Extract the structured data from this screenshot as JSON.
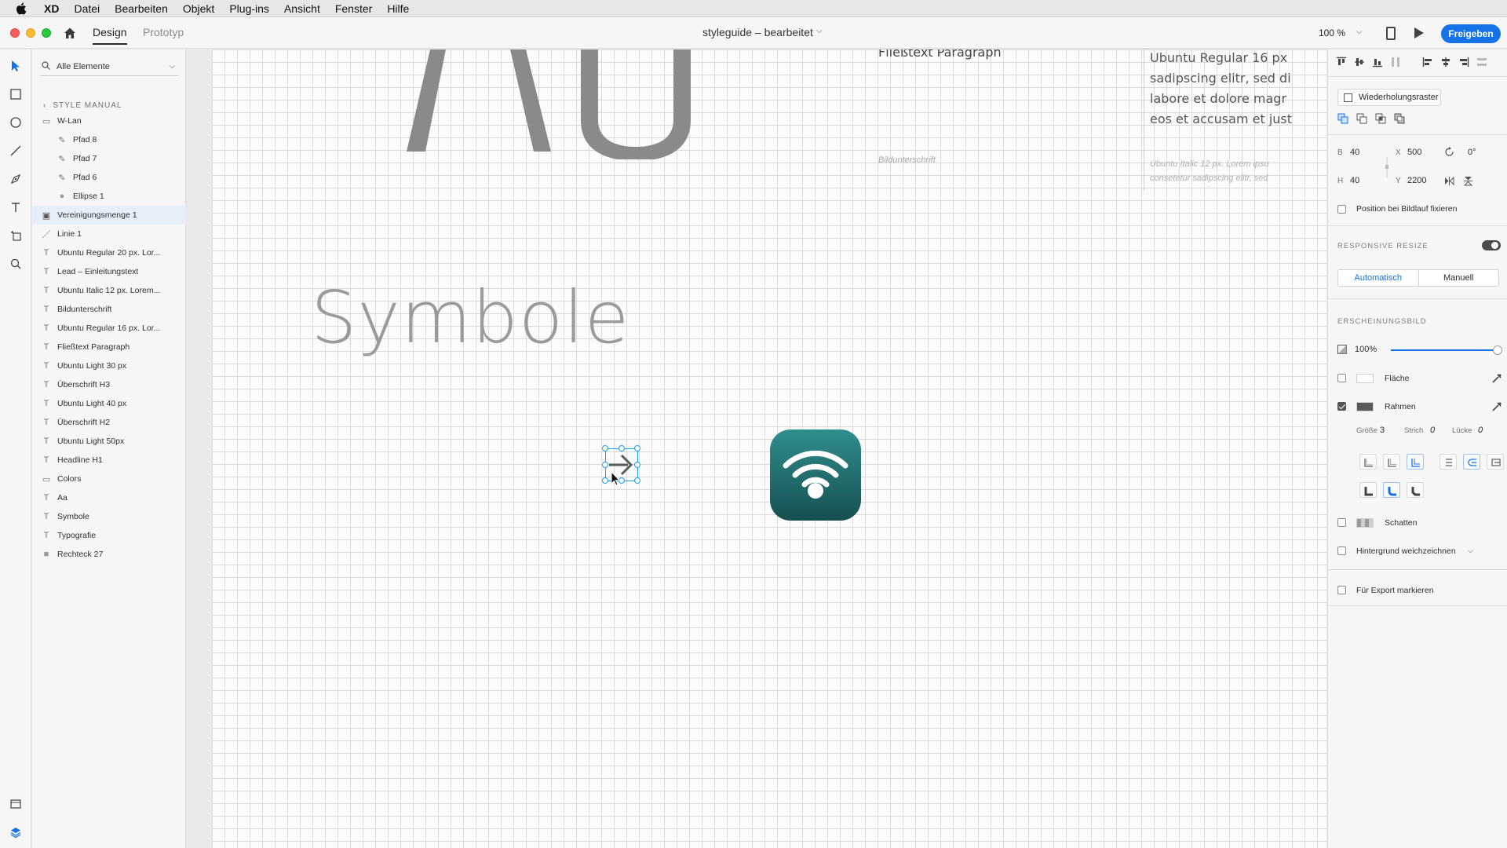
{
  "menubar": {
    "items": [
      "XD",
      "Datei",
      "Bearbeiten",
      "Objekt",
      "Plug-ins",
      "Ansicht",
      "Fenster",
      "Hilfe"
    ]
  },
  "appbar": {
    "tabs": [
      "Design",
      "Prototyp"
    ],
    "active_tab": "Design",
    "document_title": "styleguide – bearbeitet",
    "zoom": "100 %",
    "share_label": "Freigeben"
  },
  "layers": {
    "search_placeholder": "Alle Elemente",
    "breadcrumb": "STYLE MANUAL",
    "items": [
      {
        "name": "W-Lan",
        "type": "folder",
        "indent": 0
      },
      {
        "name": "Pfad 8",
        "type": "path",
        "indent": 1
      },
      {
        "name": "Pfad 7",
        "type": "path",
        "indent": 1
      },
      {
        "name": "Pfad 6",
        "type": "path",
        "indent": 1
      },
      {
        "name": "Ellipse 1",
        "type": "ellipse",
        "indent": 1
      },
      {
        "name": "Vereinigungsmenge 1",
        "type": "union",
        "indent": 0,
        "selected": true
      },
      {
        "name": "Linie 1",
        "type": "line",
        "indent": 0
      },
      {
        "name": "Ubuntu Regular 20 px. Lor...",
        "type": "text",
        "indent": 0
      },
      {
        "name": "Lead – Einleitungstext",
        "type": "text",
        "indent": 0
      },
      {
        "name": "Ubuntu Italic 12 px. Lorem...",
        "type": "text",
        "indent": 0
      },
      {
        "name": "Bildunterschrift",
        "type": "text",
        "indent": 0
      },
      {
        "name": "Ubuntu Regular 16 px. Lor...",
        "type": "text",
        "indent": 0
      },
      {
        "name": "Fließtext Paragraph",
        "type": "text",
        "indent": 0
      },
      {
        "name": "Ubuntu Light 30 px",
        "type": "text",
        "indent": 0
      },
      {
        "name": "Überschrift H3",
        "type": "text",
        "indent": 0
      },
      {
        "name": "Ubuntu Light 40 px",
        "type": "text",
        "indent": 0
      },
      {
        "name": "Überschrift H2",
        "type": "text",
        "indent": 0
      },
      {
        "name": "Ubuntu Light 50px",
        "type": "text",
        "indent": 0
      },
      {
        "name": "Headline H1",
        "type": "text",
        "indent": 0
      },
      {
        "name": "Colors",
        "type": "folder",
        "indent": 0
      },
      {
        "name": "Aa",
        "type": "text",
        "indent": 0
      },
      {
        "name": "Symbole",
        "type": "text",
        "indent": 0
      },
      {
        "name": "Typografie",
        "type": "text",
        "indent": 0
      },
      {
        "name": "Rechteck 27",
        "type": "rect",
        "indent": 0
      }
    ]
  },
  "canvas": {
    "heading": "Symbole",
    "paragraph_title": "Fließtext Paragraph",
    "caption": "Bildunterschrift",
    "lorem16_lines": [
      "Ubuntu Regular 16 px",
      "sadipscing elitr, sed di",
      "labore et dolore magr",
      "eos et accusam et just"
    ],
    "lorem12_lines": [
      "Ubuntu Italic 12 px. Lorem ipsu",
      "consetetur sadipscing elitr, sed"
    ]
  },
  "inspector": {
    "repeat_grid_label": "Wiederholungsraster",
    "w_label": "B",
    "w_value": "40",
    "h_label": "H",
    "h_value": "40",
    "x_label": "X",
    "x_value": "500",
    "y_label": "Y",
    "y_value": "2200",
    "rotation": "0°",
    "fix_position_label": "Position bei Bildlauf fixieren",
    "responsive_title": "RESPONSIVE RESIZE",
    "responsive_on": true,
    "resize_auto": "Automatisch",
    "resize_manual": "Manuell",
    "appearance_title": "ERSCHEINUNGSBILD",
    "opacity_text": "100%",
    "opacity_fraction": 1.0,
    "fill_label": "Fläche",
    "fill_checked": false,
    "fill_color": "#ffffff",
    "border_label": "Rahmen",
    "border_checked": true,
    "border_color": "#5a5a5a",
    "size_label": "Größe",
    "size_value": "3",
    "dash_label": "Strich",
    "dash_value": "0",
    "gap_label": "Lücke",
    "gap_value": "0",
    "shadow_label": "Schatten",
    "blur_label": "Hintergrund weichzeichnen",
    "export_label": "Für Export markieren"
  },
  "colors": {
    "accent": "#1473e6",
    "selection": "#18a0fb",
    "wifi_tile_top": "#2f8f8c",
    "wifi_tile_bottom": "#174f52"
  }
}
